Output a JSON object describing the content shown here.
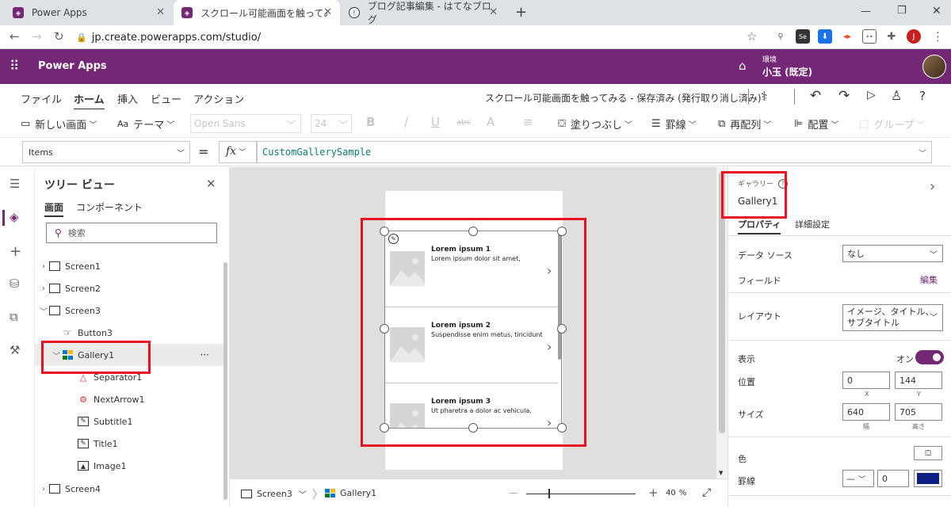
{
  "browser": {
    "tabs": [
      {
        "title": "Power Apps",
        "active": false
      },
      {
        "title": "スクロール可能画面を触ってみる - 保",
        "active": true
      },
      {
        "title": "ブログ記事編集 - はてなブログ",
        "active": false
      }
    ],
    "url": "jp.create.powerapps.com/studio/",
    "avatar_letter": "J"
  },
  "app": {
    "name": "Power Apps",
    "env_label": "環境",
    "env_value": "小玉 (既定)"
  },
  "menu": {
    "items": [
      "ファイル",
      "ホーム",
      "挿入",
      "ビュー",
      "アクション"
    ],
    "active": "ホーム",
    "status": "スクロール可能画面を触ってみる - 保存済み (発行取り消し済み)"
  },
  "toolbar": {
    "new_screen": "新しい画面",
    "theme": "テーマ",
    "font": "Open Sans",
    "font_size": "24",
    "bold": "B",
    "italic": "/",
    "underline": "U",
    "strike": "abc",
    "fontcolor": "A",
    "align": "≡",
    "fill": "塗りつぶし",
    "border": "罫線",
    "reorder": "再配列",
    "align2": "配置",
    "group": "グループ"
  },
  "formula": {
    "property": "Items",
    "eq": "=",
    "fx": "fx",
    "value": "CustomGallerySample"
  },
  "tree": {
    "title": "ツリー ビュー",
    "tab_screen": "画面",
    "tab_component": "コンポーネント",
    "search_placeholder": "検索",
    "nodes": [
      "Screen1",
      "Screen2",
      "Screen3",
      "Button3",
      "Gallery1",
      "Separator1",
      "NextArrow1",
      "Subtitle1",
      "Title1",
      "Image1",
      "Screen4"
    ],
    "more": "···"
  },
  "gallery": {
    "items": [
      {
        "title": "Lorem ipsum 1",
        "subtitle": "Lorem ipsum dolor sit amet,"
      },
      {
        "title": "Lorem ipsum 2",
        "subtitle": "Suspendisse enim metus, tincidunt"
      },
      {
        "title": "Lorem ipsum 3",
        "subtitle": "Ut pharetra a dolor ac vehicula."
      }
    ]
  },
  "bottom": {
    "screen": "Screen3",
    "gallery": "Gallery1",
    "zoom": "40",
    "zoom_unit": "%",
    "minus": "—",
    "plus": "+"
  },
  "props": {
    "type_label": "ギャラリー",
    "name": "Gallery1",
    "tab_props": "プロパティ",
    "tab_advanced": "詳細設定",
    "datasource_label": "データ ソース",
    "datasource_value": "なし",
    "fields_label": "フィールド",
    "fields_edit": "編集",
    "layout_label": "レイアウト",
    "layout_value_1": "イメージ、タイトル、",
    "layout_value_2": "サブタイトル",
    "visible_label": "表示",
    "visible_value": "オン",
    "position_label": "位置",
    "pos_x": "0",
    "pos_y": "144",
    "x_label": "X",
    "y_label": "Y",
    "size_label": "サイズ",
    "width": "640",
    "height": "705",
    "w_label": "幅",
    "h_label": "高さ",
    "color_label": "色",
    "border_label": "罫線",
    "border_width": "0"
  },
  "colors": {
    "brand": "#742774",
    "highlight": "#e81123",
    "border_swatch": "#0f1e82"
  }
}
